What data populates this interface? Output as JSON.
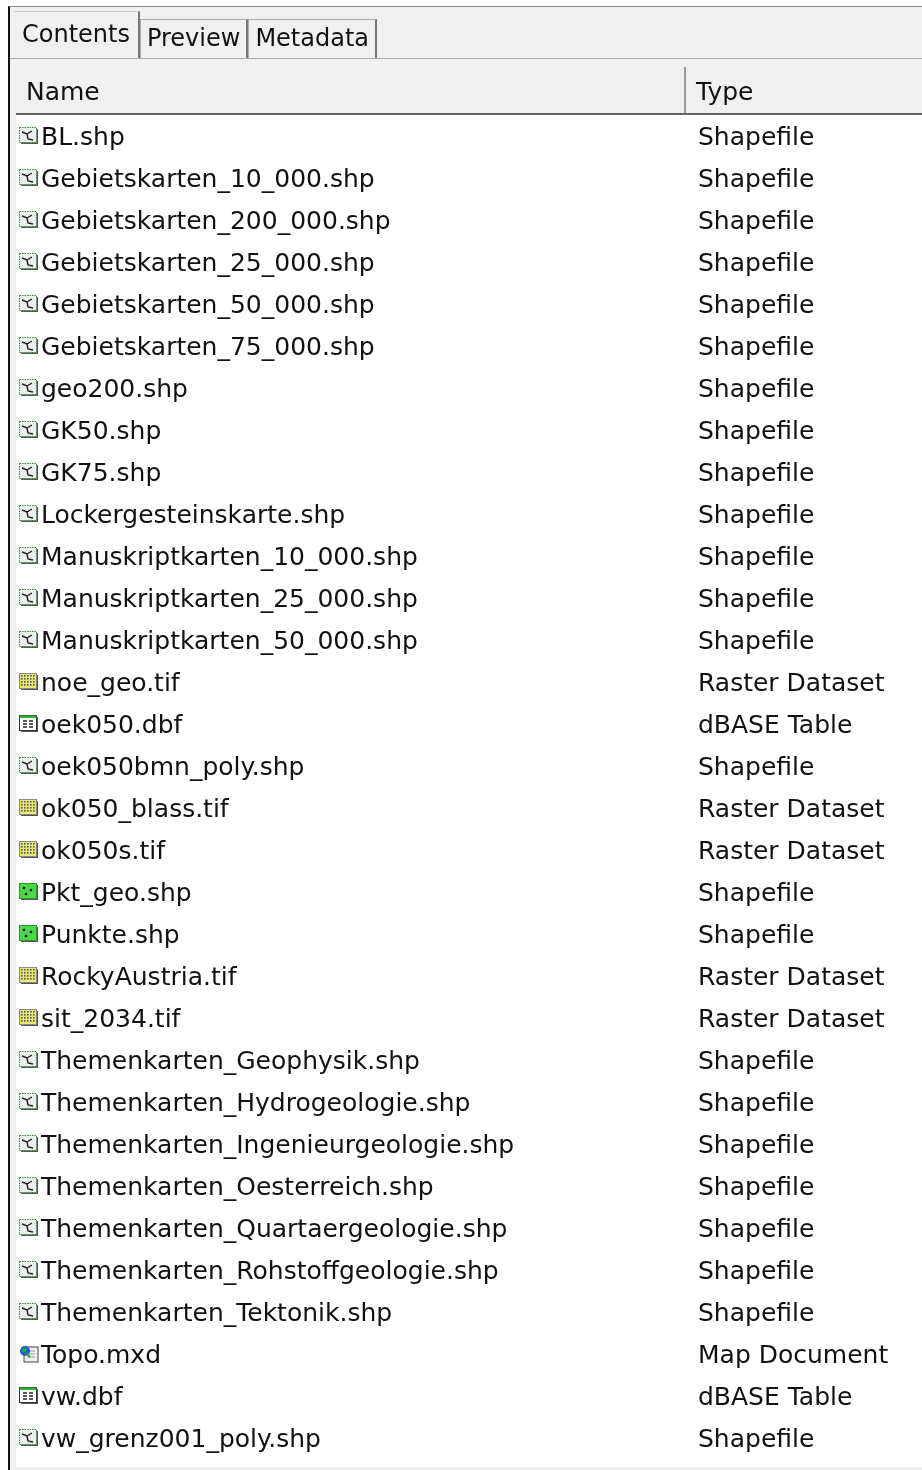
{
  "tabs": [
    {
      "label": "Contents",
      "selected": true
    },
    {
      "label": "Preview",
      "selected": false
    },
    {
      "label": "Metadata",
      "selected": false
    }
  ],
  "table": {
    "columns": [
      "Name",
      "Type"
    ],
    "rows": [
      {
        "kind": "polygon",
        "name": "BL.shp",
        "type": "Shapefile"
      },
      {
        "kind": "polygon",
        "name": "Gebietskarten_10_000.shp",
        "type": "Shapefile"
      },
      {
        "kind": "polygon",
        "name": "Gebietskarten_200_000.shp",
        "type": "Shapefile"
      },
      {
        "kind": "polygon",
        "name": "Gebietskarten_25_000.shp",
        "type": "Shapefile"
      },
      {
        "kind": "polygon",
        "name": "Gebietskarten_50_000.shp",
        "type": "Shapefile"
      },
      {
        "kind": "polygon",
        "name": "Gebietskarten_75_000.shp",
        "type": "Shapefile"
      },
      {
        "kind": "polygon",
        "name": "geo200.shp",
        "type": "Shapefile"
      },
      {
        "kind": "polygon",
        "name": "GK50.shp",
        "type": "Shapefile"
      },
      {
        "kind": "polygon",
        "name": "GK75.shp",
        "type": "Shapefile"
      },
      {
        "kind": "polygon",
        "name": "Lockergesteinskarte.shp",
        "type": "Shapefile"
      },
      {
        "kind": "polygon",
        "name": "Manuskriptkarten_10_000.shp",
        "type": "Shapefile"
      },
      {
        "kind": "polygon",
        "name": "Manuskriptkarten_25_000.shp",
        "type": "Shapefile"
      },
      {
        "kind": "polygon",
        "name": "Manuskriptkarten_50_000.shp",
        "type": "Shapefile"
      },
      {
        "kind": "raster",
        "name": "noe_geo.tif",
        "type": "Raster Dataset"
      },
      {
        "kind": "table",
        "name": "oek050.dbf",
        "type": "dBASE Table"
      },
      {
        "kind": "polygon",
        "name": "oek050bmn_poly.shp",
        "type": "Shapefile"
      },
      {
        "kind": "raster",
        "name": "ok050_blass.tif",
        "type": "Raster Dataset"
      },
      {
        "kind": "raster",
        "name": "ok050s.tif",
        "type": "Raster Dataset"
      },
      {
        "kind": "point",
        "name": "Pkt_geo.shp",
        "type": "Shapefile"
      },
      {
        "kind": "point",
        "name": "Punkte.shp",
        "type": "Shapefile"
      },
      {
        "kind": "raster",
        "name": "RockyAustria.tif",
        "type": "Raster Dataset"
      },
      {
        "kind": "raster",
        "name": "sit_2034.tif",
        "type": "Raster Dataset"
      },
      {
        "kind": "polygon",
        "name": "Themenkarten_Geophysik.shp",
        "type": "Shapefile"
      },
      {
        "kind": "polygon",
        "name": "Themenkarten_Hydrogeologie.shp",
        "type": "Shapefile"
      },
      {
        "kind": "polygon",
        "name": "Themenkarten_Ingenieurgeologie.shp",
        "type": "Shapefile"
      },
      {
        "kind": "polygon",
        "name": "Themenkarten_Oesterreich.shp",
        "type": "Shapefile"
      },
      {
        "kind": "polygon",
        "name": "Themenkarten_Quartaergeologie.shp",
        "type": "Shapefile"
      },
      {
        "kind": "polygon",
        "name": "Themenkarten_Rohstoffgeologie.shp",
        "type": "Shapefile"
      },
      {
        "kind": "polygon",
        "name": "Themenkarten_Tektonik.shp",
        "type": "Shapefile"
      },
      {
        "kind": "map",
        "name": "Topo.mxd",
        "type": "Map Document"
      },
      {
        "kind": "table",
        "name": "vw.dbf",
        "type": "dBASE Table"
      },
      {
        "kind": "polygon",
        "name": "vw_grenz001_poly.shp",
        "type": "Shapefile"
      }
    ]
  }
}
